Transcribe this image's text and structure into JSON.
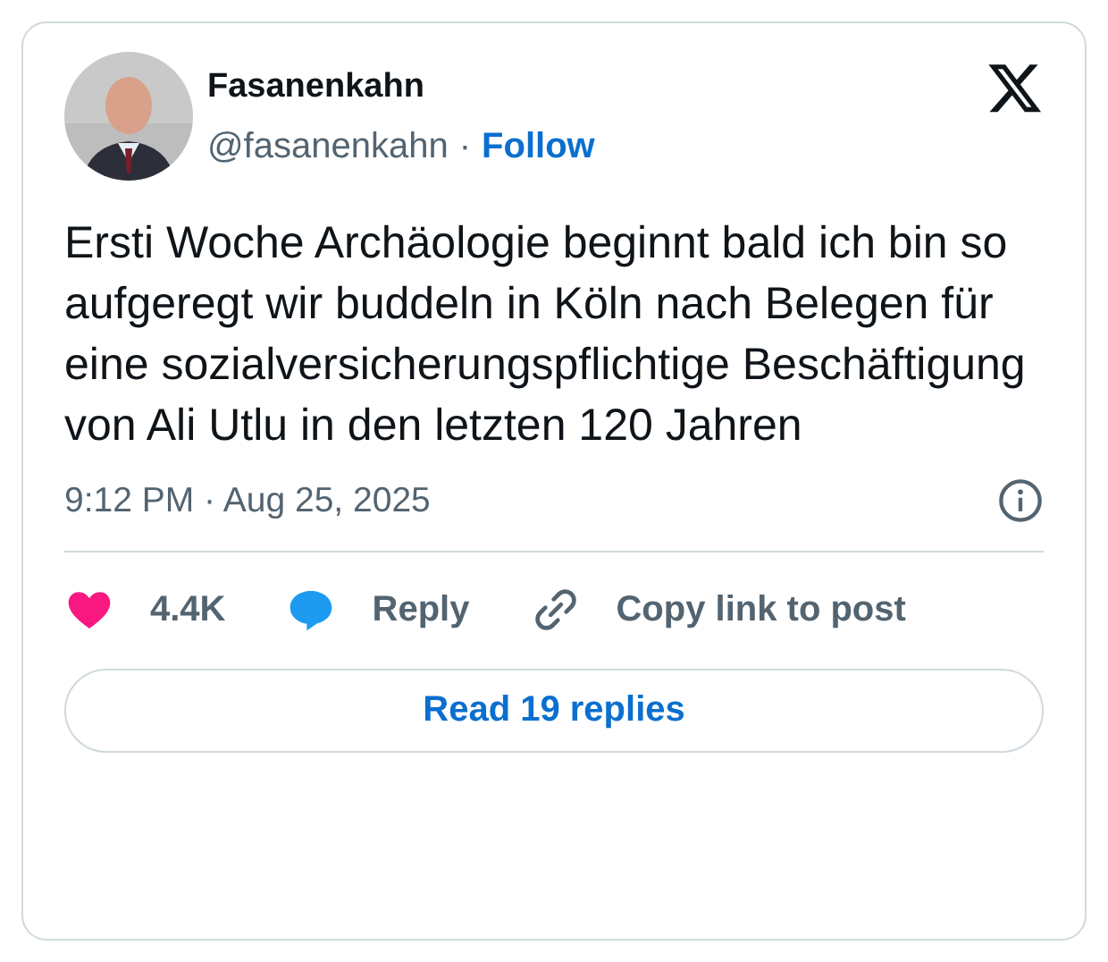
{
  "author": {
    "name": "Fasanenkahn",
    "handle": "@fasanenkahn",
    "separator": "·",
    "follow": "Follow"
  },
  "text": "Ersti Woche Archäologie beginnt bald ich bin so aufgeregt wir buddeln in Köln nach Belegen für eine sozialversicherungspflichtige Beschäftigung von Ali Utlu in den letzten 120 Jahren",
  "timestamp": "9:12 PM · Aug 25, 2025",
  "actions": [
    {
      "kind": "like",
      "label": "4.4K"
    },
    {
      "kind": "reply",
      "label": "Reply"
    },
    {
      "kind": "link",
      "label": "Copy link to post"
    }
  ],
  "read_button": "Read 19 replies"
}
